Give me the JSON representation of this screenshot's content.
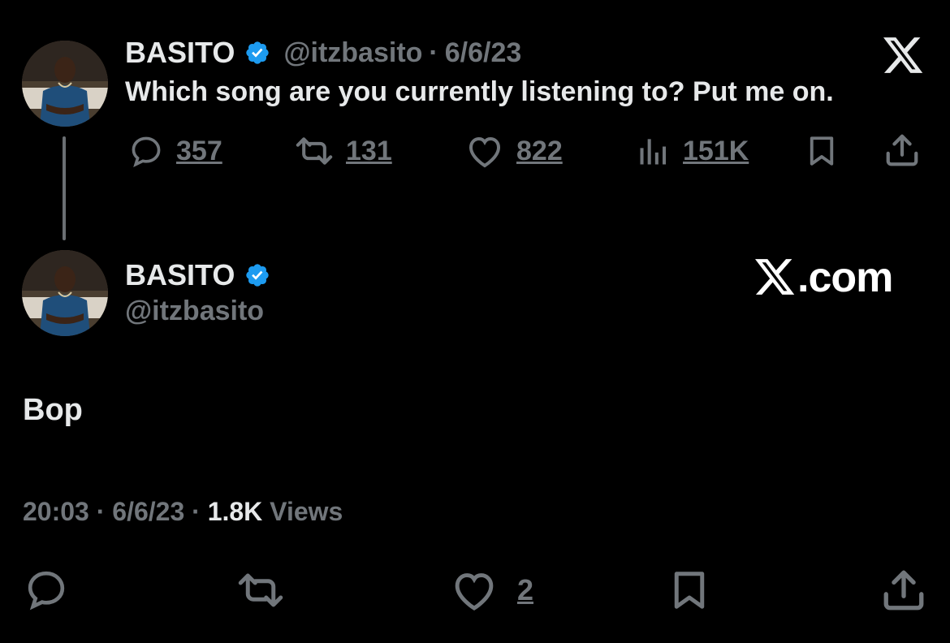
{
  "original_tweet": {
    "author_name": "BASITO",
    "handle": "@itzbasito",
    "separator": "·",
    "date": "6/6/23",
    "text": "Which song are you currently listening to? Put me on.",
    "stats": {
      "replies": "357",
      "reposts": "131",
      "likes": "822",
      "views": "151K"
    }
  },
  "reply_tweet": {
    "author_name": "BASITO",
    "handle": "@itzbasito",
    "text": "Bop",
    "time": "20:03",
    "separator1": "·",
    "date": "6/6/23",
    "separator2": "·",
    "views_count": "1.8K",
    "views_label": "Views",
    "likes": "2"
  },
  "branding": {
    "domain_text": ".com"
  },
  "colors": {
    "background": "#000000",
    "text_primary": "#e7e9ea",
    "text_secondary": "#71767b",
    "verified_blue": "#1d9bf0"
  },
  "icons": {
    "reply": "reply-icon",
    "repost": "repost-icon",
    "like": "like-icon",
    "views": "views-icon",
    "bookmark": "bookmark-icon",
    "share": "share-icon",
    "verified": "verified-badge-icon",
    "x_logo": "x-logo-icon"
  }
}
